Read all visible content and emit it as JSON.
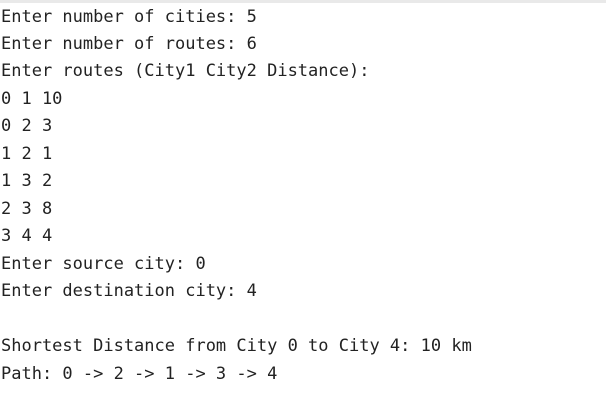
{
  "console": {
    "lines": [
      "Enter number of cities: 5",
      "Enter number of routes: 6",
      "Enter routes (City1 City2 Distance):",
      "0 1 10",
      "0 2 3",
      "1 2 1",
      "1 3 2",
      "2 3 8",
      "3 4 4",
      "Enter source city: 0",
      "Enter destination city: 4",
      "",
      "Shortest Distance from City 0 to City 4: 10 km",
      "Path: 0 -> 2 -> 1 -> 3 -> 4"
    ]
  }
}
